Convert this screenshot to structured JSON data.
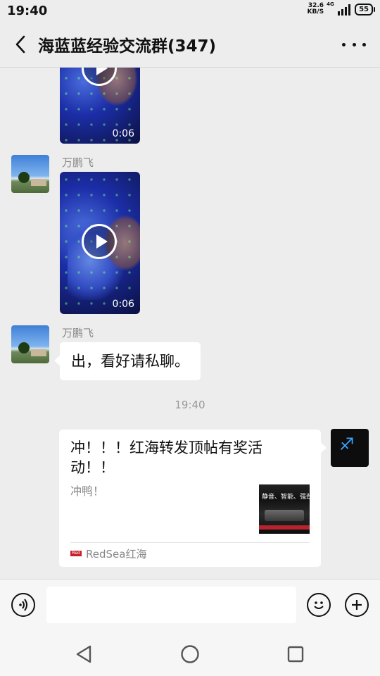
{
  "status_bar": {
    "time": "19:40",
    "net_speed_value": "32.6",
    "net_speed_unit": "KB/S",
    "signal_type": "4G",
    "battery": "55"
  },
  "header": {
    "title": "海蓝蓝经验交流群(347)",
    "back_icon": "chevron-left-icon",
    "more_icon": "more-dots-icon"
  },
  "messages": [
    {
      "type": "video",
      "sender": "",
      "duration": "0:06"
    },
    {
      "type": "video",
      "sender": "万鹏飞",
      "duration": "0:06"
    },
    {
      "type": "text",
      "sender": "万鹏飞",
      "text": "出，看好请私聊。"
    },
    {
      "type": "timestamp",
      "text": "19:40"
    },
    {
      "type": "link_card",
      "title": "冲！！！红海转发顶帖有奖活动！！",
      "description": "冲鸭！",
      "thumbnail_text": "静音、智能、强劲",
      "source": "RedSea红海",
      "source_badge": "Red Sea"
    }
  ],
  "input_bar": {
    "text_value": "",
    "voice_icon": "voice-icon",
    "emoji_icon": "emoji-icon",
    "plus_icon": "plus-icon"
  },
  "nav_bar": {
    "back_icon": "triangle-back-icon",
    "home_icon": "circle-home-icon",
    "recent_icon": "square-recent-icon"
  }
}
